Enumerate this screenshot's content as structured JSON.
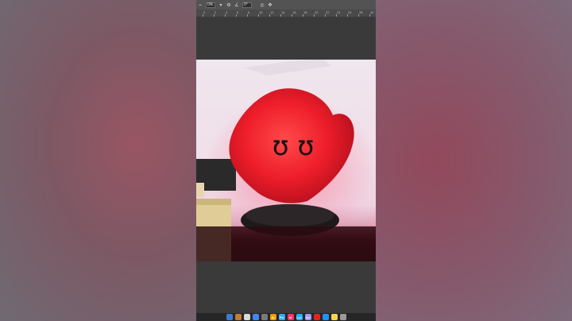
{
  "options_bar": {
    "percent_label": "0%",
    "angle_label": "0°"
  },
  "ruler": {
    "ticks": [
      "0",
      "2",
      "4",
      "6",
      "8",
      "10",
      "12",
      "14",
      "16",
      "18",
      "20",
      "22",
      "24",
      "26",
      "28",
      "30"
    ]
  },
  "photo": {
    "subject_face_glyph": "ʊ ʊ"
  },
  "dock": {
    "apps": [
      {
        "icon": "finder-icon",
        "label": "",
        "color": "#3a7bd5"
      },
      {
        "icon": "launchpad-icon",
        "label": "",
        "color": "#c27c3a"
      },
      {
        "icon": "calendar-icon",
        "label": "",
        "color": "#d9d9d9"
      },
      {
        "icon": "chrome-icon",
        "label": "",
        "color": "#4285f4"
      },
      {
        "icon": "settings-icon",
        "label": "",
        "color": "#7a7a7a"
      },
      {
        "icon": "illustrator-icon",
        "label": "Ai",
        "color": "#f29a00"
      },
      {
        "icon": "photoshop-icon",
        "label": "Ps",
        "color": "#31a8ff"
      },
      {
        "icon": "indesign-icon",
        "label": "Id",
        "color": "#ff3366"
      },
      {
        "icon": "lightroom-icon",
        "label": "Lrc",
        "color": "#31a8ff"
      },
      {
        "icon": "aftereffects-icon",
        "label": "Ae",
        "color": "#9999ff"
      },
      {
        "icon": "acrobat-icon",
        "label": "",
        "color": "#e3241b"
      },
      {
        "icon": "safari-icon",
        "label": "",
        "color": "#1e90ff"
      },
      {
        "icon": "notes-icon",
        "label": "",
        "color": "#f5d64b"
      },
      {
        "icon": "trash-icon",
        "label": "",
        "color": "#9a9a9a"
      }
    ]
  }
}
